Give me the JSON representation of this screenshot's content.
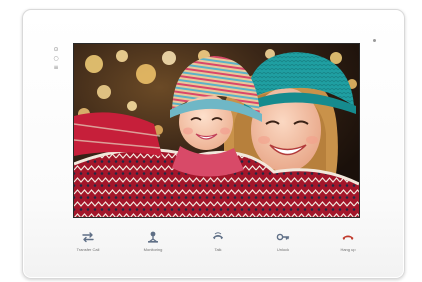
{
  "device": {
    "status_icons": [
      "⊙",
      "○",
      "≡"
    ],
    "colors": {
      "body": "#ffffff",
      "icon_grey": "#5f6f86",
      "icon_red": "#c0392b"
    }
  },
  "screen": {
    "content": "photo-mother-and-child-in-knit-hats"
  },
  "controls": [
    {
      "icon": "transfer-call-icon",
      "label": "Transfer Call"
    },
    {
      "icon": "monitoring-icon",
      "label": "Monitoring"
    },
    {
      "icon": "talk-icon",
      "label": "Talk"
    },
    {
      "icon": "unlock-icon",
      "label": "Unlock"
    },
    {
      "icon": "hang-up-icon",
      "label": "Hang up"
    }
  ]
}
